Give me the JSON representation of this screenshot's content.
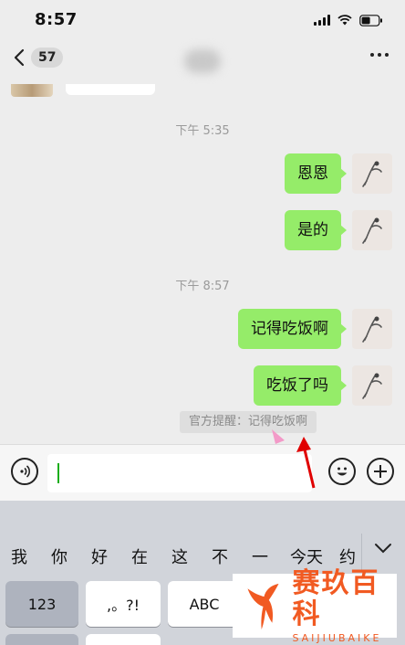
{
  "status_bar": {
    "time": "8:57"
  },
  "nav": {
    "unread_count": "57",
    "icons": [
      "chevron-left-icon",
      "more-icon"
    ]
  },
  "chat": {
    "timestamps": [
      "下午 5:35",
      "下午 8:57"
    ],
    "messages": [
      {
        "text": "恩恩",
        "sender": "self"
      },
      {
        "text": "是的",
        "sender": "self"
      },
      {
        "text": "记得吃饭啊",
        "sender": "self"
      },
      {
        "text": "吃饭了吗",
        "sender": "self"
      }
    ],
    "system_notice": "官方提醒：记得吃饭啊"
  },
  "input_bar": {
    "voice_icon": "voice-icon",
    "emoji_icon": "emoji-icon",
    "plus_icon": "plus-icon"
  },
  "keyboard": {
    "suggestions": [
      "我",
      "你",
      "好",
      "在",
      "这",
      "不",
      "一",
      "今天",
      "约"
    ],
    "keys": {
      "num": "123",
      "punct": ",。?!",
      "abc": "ABC"
    }
  },
  "colors": {
    "self_bubble": "#95ec69",
    "accent_green": "#1aad19",
    "watermark": "#f15a22",
    "annotation_red": "#e00000"
  },
  "watermark": {
    "cn": "赛玖百科",
    "en": "SAIJIUBAIKE"
  }
}
